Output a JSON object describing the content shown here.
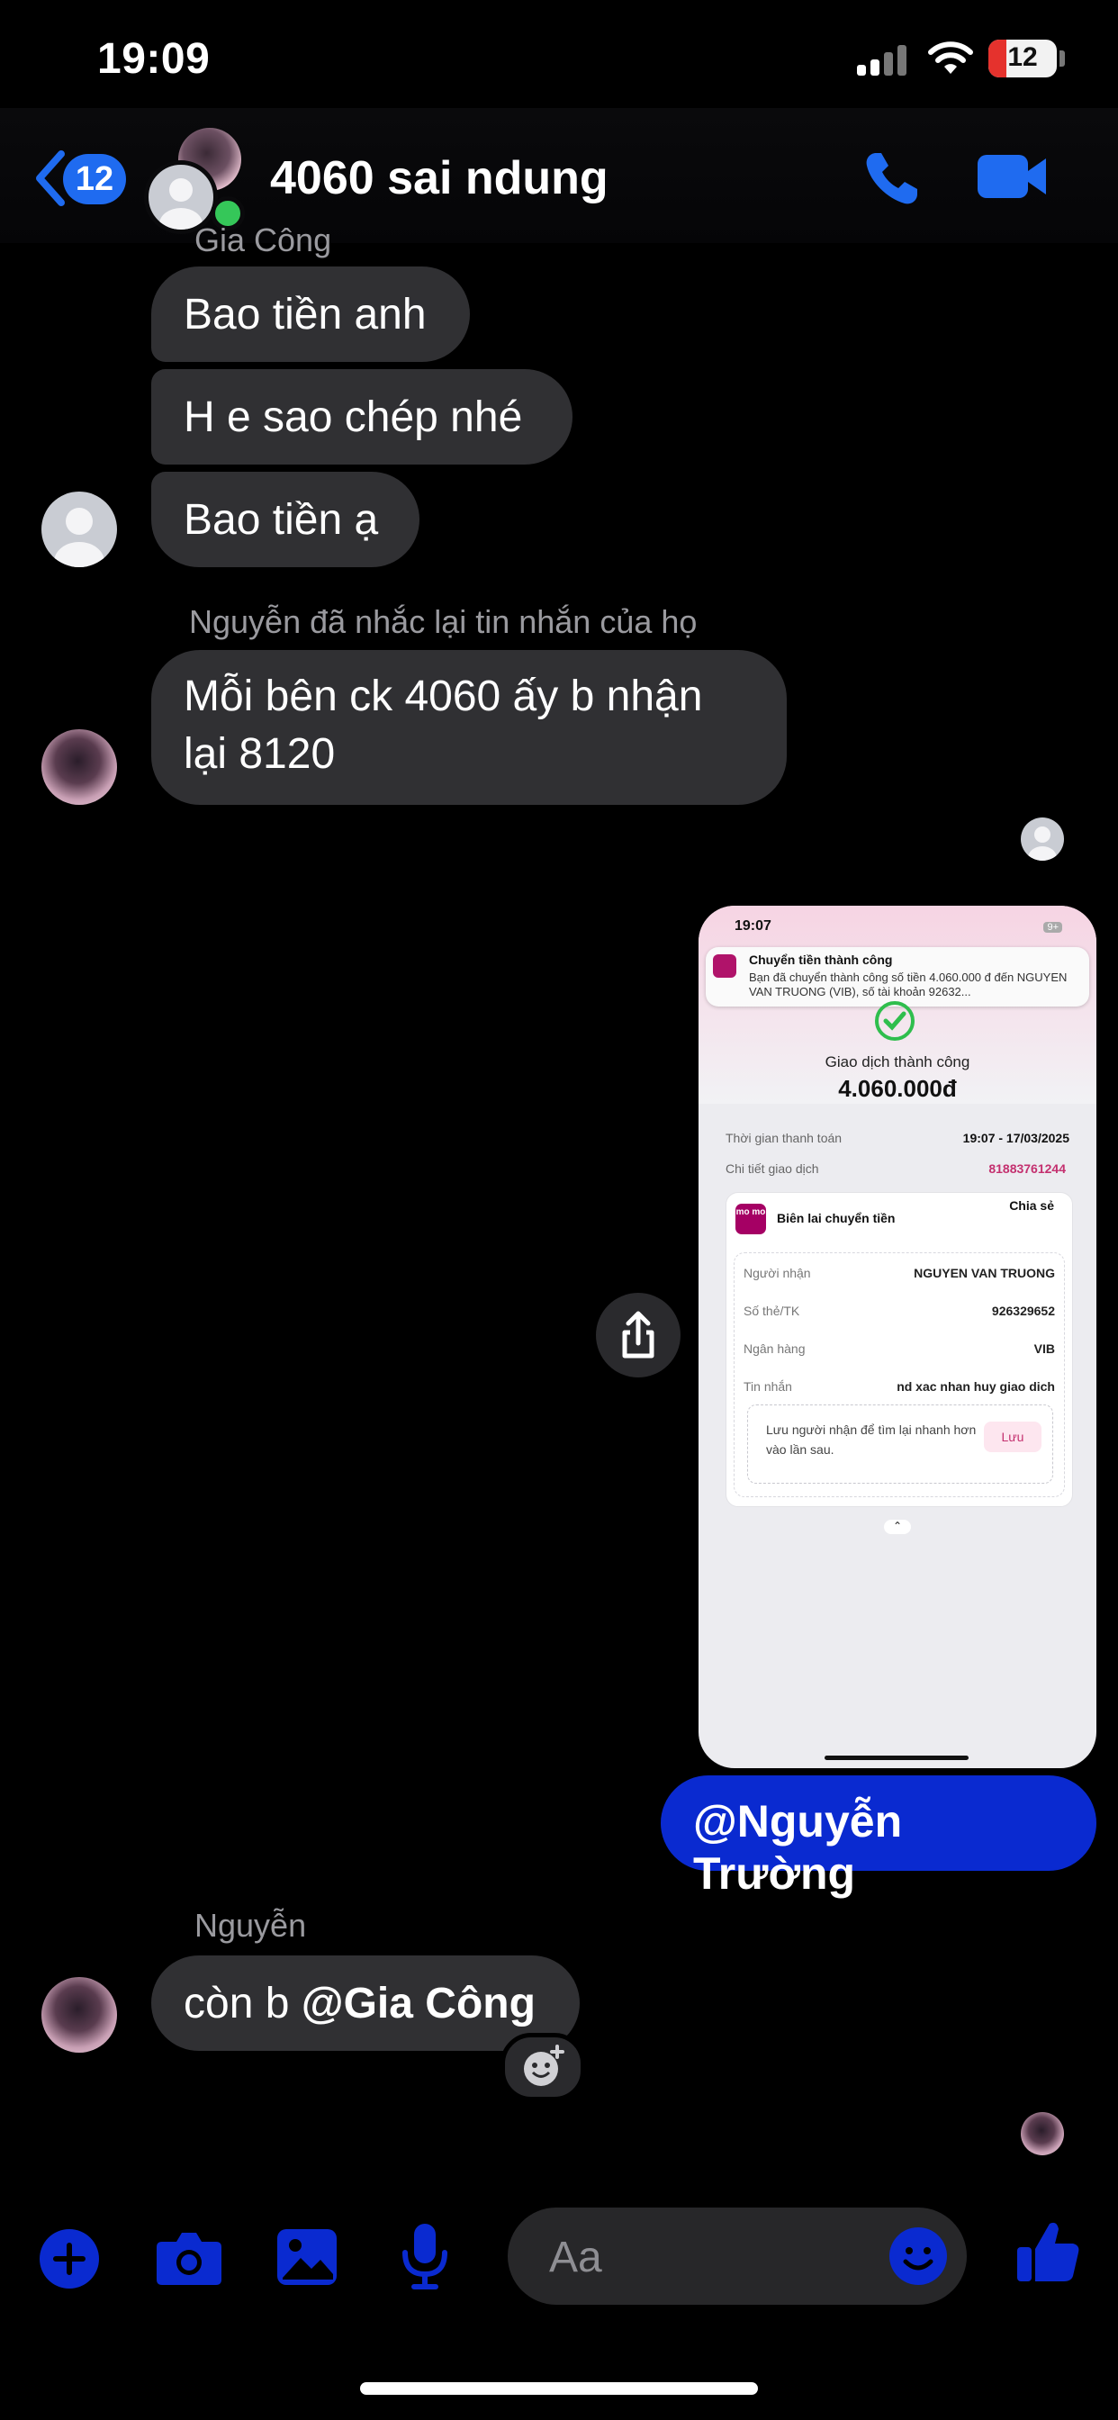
{
  "status_bar": {
    "time": "19:09",
    "battery": "12"
  },
  "header": {
    "unread_count": "12",
    "chat_name": "4060 sai ndung"
  },
  "messages": {
    "top_sender": "Gia Công",
    "m1": "Bao tiền anh",
    "m2": "H e sao chép nhé",
    "m3": "Bao tiền ạ",
    "mention_notice": "Nguyễn đã nhắc lại tin nhắn của họ",
    "m4_line1": "Mỗi bên ck 4060 ấy b nhận",
    "m4_line2": "lại 8120",
    "outgoing": "@Nguyễn Trường",
    "sender2": "Nguyễn",
    "m5_prefix": "còn b ",
    "m5_mention": "@Gia Công"
  },
  "attachment": {
    "time": "19:07",
    "hd": "HD",
    "notif_title": "Chuyển tiền thành công",
    "notif_body": "Bạn đã chuyển thành công số tiền 4.060.000 đ đến NGUYEN VAN TRUONG (VIB), số tài khoản 92632...",
    "status": "Giao dịch thành công",
    "amount": "4.060.000đ",
    "time_label": "Thời gian thanh toán",
    "time_value": "19:07 - 17/03/2025",
    "detail_label": "Chi tiết giao dịch",
    "detail_value": "81883761244",
    "receipt_title": "Biên lai chuyển tiền",
    "share": "Chia sẻ",
    "recipient_label": "Người nhận",
    "recipient_value": "NGUYEN VAN TRUONG",
    "account_label": "Số thẻ/TK",
    "account_value": "926329652",
    "bank_label": "Ngân hàng",
    "bank_value": "VIB",
    "message_label": "Tin nhắn",
    "message_value": "nd xac nhan huy giao dich",
    "save_hint": "Lưu người nhận để tìm lại nhanh hơn vào lần sau.",
    "save_button": "Lưu",
    "momo_logo": "mo mo"
  },
  "composer": {
    "placeholder": "Aa"
  },
  "colors": {
    "accent": "#0a2ad0",
    "bubble": "#303033",
    "online": "#35c759",
    "badge": "#1f6bf0"
  },
  "icons": [
    "back-chevron-icon",
    "phone-icon",
    "video-camera-icon",
    "share-icon",
    "add-reaction-icon",
    "plus-icon",
    "camera-icon",
    "gallery-icon",
    "microphone-icon",
    "emoji-icon",
    "thumbs-up-icon"
  ]
}
